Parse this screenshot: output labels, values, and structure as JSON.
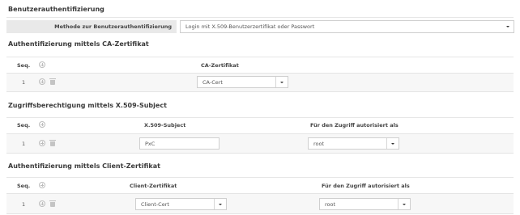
{
  "page": {
    "title": "Benutzerauthentifizierung",
    "method_label": "Methode zur Benutzerauthentifizierung",
    "method_value": "Login mit X.509-Benutzerzertifikat oder Passwort"
  },
  "ca_section": {
    "title": "Authentifizierung mittels CA-Zertifikat",
    "col_seq": "Seq.",
    "col_cert": "CA-Zertifikat",
    "rows": [
      {
        "seq": "1",
        "cert": "CA-Cert"
      }
    ]
  },
  "subject_section": {
    "title": "Zugriffsberechtigung mittels X.509-Subject",
    "col_seq": "Seq.",
    "col_subject": "X.509-Subject",
    "col_user": "Für den Zugriff autorisiert als",
    "rows": [
      {
        "seq": "1",
        "subject": "PxC",
        "user": "root"
      }
    ]
  },
  "client_section": {
    "title": "Authentifizierung mittels Client-Zertifikat",
    "col_seq": "Seq.",
    "col_cert": "Client-Zertifikat",
    "col_user": "Für den Zugriff autorisiert als",
    "rows": [
      {
        "seq": "1",
        "cert": "Client-Cert",
        "user": "root"
      }
    ]
  }
}
